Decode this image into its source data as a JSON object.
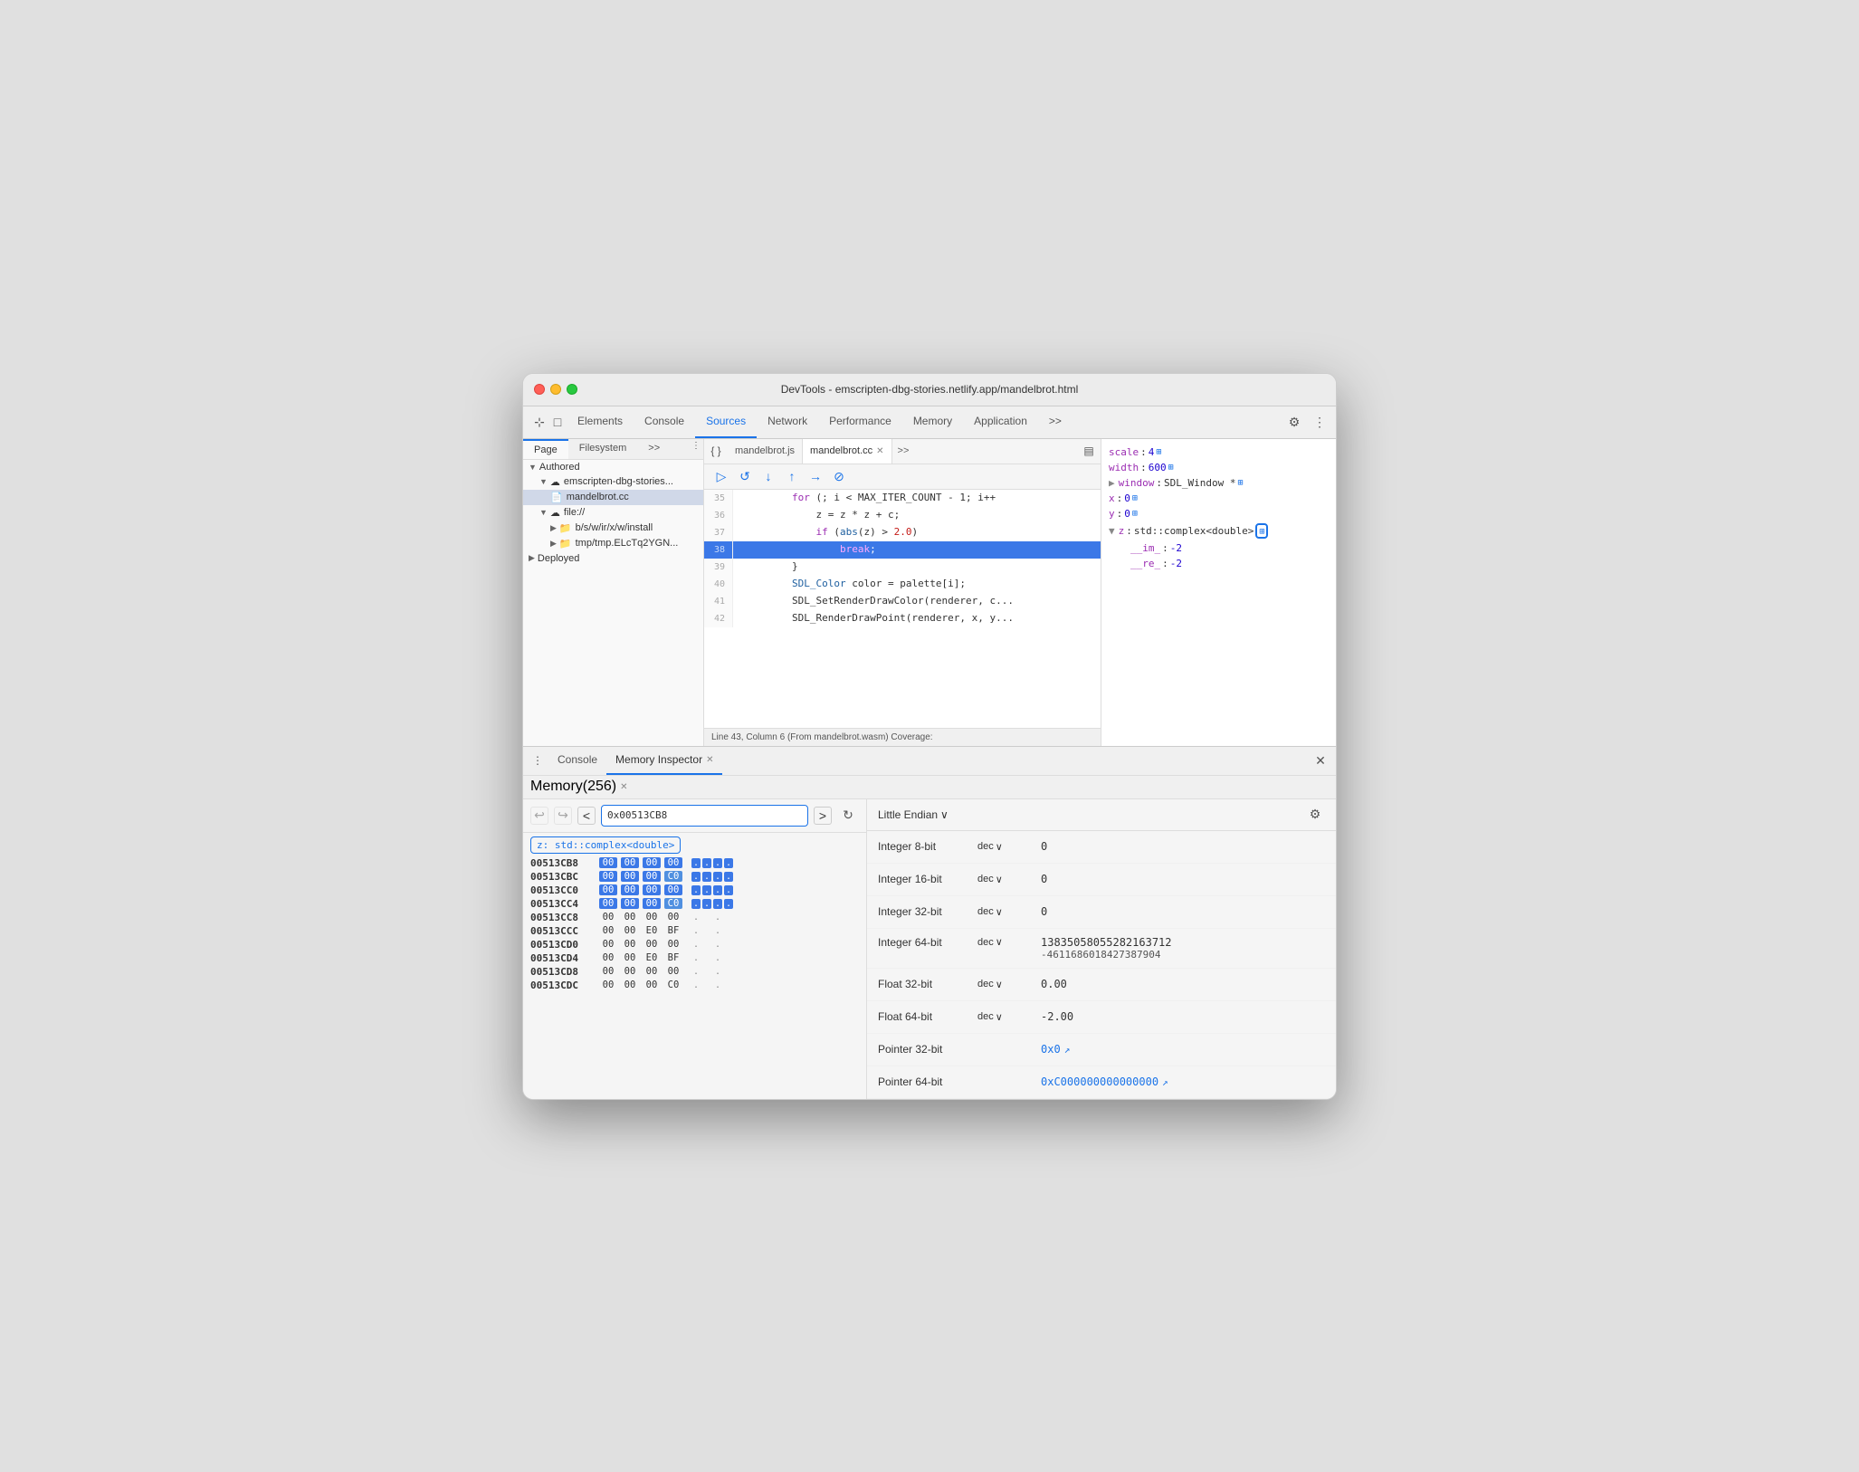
{
  "window": {
    "title": "DevTools - emscripten-dbg-stories.netlify.app/mandelbrot.html"
  },
  "tabbar": {
    "tabs": [
      {
        "id": "cursor-icon",
        "label": ""
      },
      {
        "id": "elements",
        "label": "Elements"
      },
      {
        "id": "console",
        "label": "Console"
      },
      {
        "id": "sources",
        "label": "Sources"
      },
      {
        "id": "network",
        "label": "Network"
      },
      {
        "id": "performance",
        "label": "Performance"
      },
      {
        "id": "memory",
        "label": "Memory"
      },
      {
        "id": "application",
        "label": "Application"
      },
      {
        "id": "more",
        "label": ">>"
      }
    ],
    "active": "sources"
  },
  "sidebar": {
    "sub_tabs": [
      "Page",
      "Filesystem",
      ">>"
    ],
    "active_sub_tab": "Page",
    "tree": {
      "authored": "Authored",
      "emscripten": "emscripten-dbg-stories...",
      "mandelbrot_cc": "mandelbrot.cc",
      "file": "file://",
      "install": "b/s/w/ir/x/w/install",
      "tmp": "tmp/tmp.ELcTq2YGN...",
      "deployed": "Deployed"
    }
  },
  "editor": {
    "tabs": [
      {
        "label": "mandelbrot.js",
        "active": false,
        "closeable": false
      },
      {
        "label": "mandelbrot.cc",
        "active": true,
        "closeable": true
      }
    ],
    "more_tabs": ">>",
    "lines": [
      {
        "num": "35",
        "code": "        for (; i < MAX_ITER_COUNT - 1; i++ "
      },
      {
        "num": "36",
        "code": "            z = z * z + c;"
      },
      {
        "num": "37",
        "code": "            if (abs(z) > 2.0)"
      },
      {
        "num": "38",
        "code": "                break;",
        "highlighted": true
      },
      {
        "num": "39",
        "code": "        }"
      },
      {
        "num": "40",
        "code": "        SDL_Color color = palette[i];"
      },
      {
        "num": "41",
        "code": "        SDL_SetRenderDrawColor(renderer, c..."
      },
      {
        "num": "42",
        "code": "        SDL_RenderDrawPoint(renderer, x, y..."
      }
    ],
    "status": "Line 43, Column 6 (From mandelbrot.wasm)  Coverage:"
  },
  "scope": {
    "items": [
      {
        "key": "scale",
        "colon": ":",
        "value": "4",
        "chip": true
      },
      {
        "key": "width",
        "colon": ":",
        "value": "600",
        "chip": true
      },
      {
        "key": "window",
        "colon": ":",
        "value": "SDL_Window *",
        "chip": true,
        "expandable": true
      },
      {
        "key": "x",
        "colon": ":",
        "value": "0",
        "chip": true
      },
      {
        "key": "y",
        "colon": ":",
        "value": "0",
        "chip": true
      },
      {
        "key": "z",
        "colon": ":",
        "value": "std::complex<double>",
        "chip": true,
        "highlighted": true,
        "expandable": true
      },
      {
        "key": "__im_",
        "colon": ":",
        "value": "-2",
        "indent": true
      },
      {
        "key": "__re_",
        "colon": ":",
        "value": "-2",
        "indent": true
      }
    ]
  },
  "console_section": {
    "tabs": [
      {
        "label": "Console",
        "active": false
      },
      {
        "label": "Memory Inspector",
        "active": true,
        "closeable": true
      }
    ]
  },
  "memory_tab": {
    "label": "Memory(256)",
    "closeable": true
  },
  "memory": {
    "address": "0x00513CB8",
    "label": "z: std::complex<double>",
    "endian": "Little Endian",
    "rows": [
      {
        "addr": "00513CB8",
        "bytes": [
          "00",
          "00",
          "00",
          "00"
        ],
        "chars": [
          ".",
          ".",
          ".",
          "."
        ],
        "highlight": [
          0,
          1,
          2,
          3
        ]
      },
      {
        "addr": "00513CBC",
        "bytes": [
          "00",
          "00",
          "00",
          "C0"
        ],
        "chars": [
          ".",
          ".",
          ".",
          "."
        ],
        "highlight": [
          0,
          1,
          2,
          3
        ]
      },
      {
        "addr": "00513CC0",
        "bytes": [
          "00",
          "00",
          "00",
          "00"
        ],
        "chars": [
          ".",
          ".",
          ".",
          "."
        ],
        "highlight": [
          0,
          1,
          2,
          3
        ]
      },
      {
        "addr": "00513CC4",
        "bytes": [
          "00",
          "00",
          "00",
          "C0"
        ],
        "chars": [
          ".",
          ".",
          ".",
          "."
        ],
        "highlight": [
          0,
          1,
          2,
          3
        ]
      },
      {
        "addr": "00513CC8",
        "bytes": [
          "00",
          "00",
          "00",
          "00"
        ],
        "chars": [
          ".",
          " ",
          ".",
          " "
        ],
        "highlight": []
      },
      {
        "addr": "00513CCC",
        "bytes": [
          "00",
          "00",
          "E0",
          "BF"
        ],
        "chars": [
          ".",
          " ",
          ".",
          " "
        ],
        "highlight": []
      },
      {
        "addr": "00513CD0",
        "bytes": [
          "00",
          "00",
          "00",
          "00"
        ],
        "chars": [
          ".",
          " ",
          ".",
          " "
        ],
        "highlight": []
      },
      {
        "addr": "00513CD4",
        "bytes": [
          "00",
          "00",
          "E0",
          "BF"
        ],
        "chars": [
          ".",
          " ",
          ".",
          " "
        ],
        "highlight": []
      },
      {
        "addr": "00513CD8",
        "bytes": [
          "00",
          "00",
          "00",
          "00"
        ],
        "chars": [
          ".",
          " ",
          ".",
          " "
        ],
        "highlight": []
      },
      {
        "addr": "00513CDC",
        "bytes": [
          "00",
          "00",
          "00",
          "C0"
        ],
        "chars": [
          ".",
          " ",
          ".",
          " "
        ],
        "highlight": []
      }
    ]
  },
  "interpretation": {
    "endian": "Little Endian",
    "rows": [
      {
        "label": "Integer 8-bit",
        "format": "dec",
        "value": "0"
      },
      {
        "label": "Integer 16-bit",
        "format": "dec",
        "value": "0"
      },
      {
        "label": "Integer 32-bit",
        "format": "dec",
        "value": "0"
      },
      {
        "label": "Integer 64-bit",
        "format": "dec",
        "value": "13835058055282163712",
        "value2": "-4611686018427387904"
      },
      {
        "label": "Float 32-bit",
        "format": "dec",
        "value": "0.00"
      },
      {
        "label": "Float 64-bit",
        "format": "dec",
        "value": "-2.00"
      },
      {
        "label": "Pointer 32-bit",
        "format": "",
        "value": "0x0",
        "link": true
      },
      {
        "label": "Pointer 64-bit",
        "format": "",
        "value": "0xC000000000000000",
        "link": true
      }
    ]
  }
}
